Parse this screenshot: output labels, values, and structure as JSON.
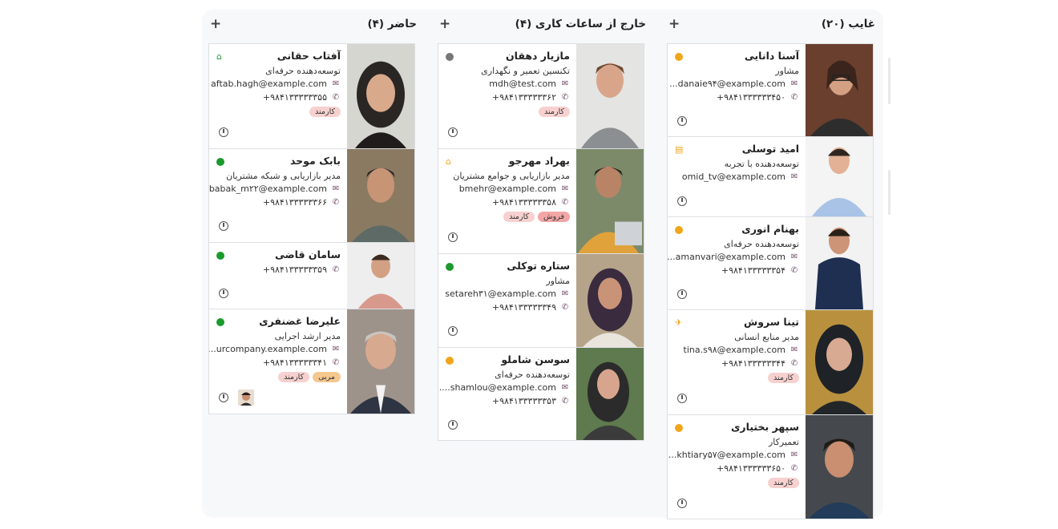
{
  "columns": [
    {
      "title": "غایب (۲۰)",
      "add": "+",
      "cards": [
        {
          "name": "آسنا دانایی",
          "job": "مشاور",
          "email": "...danaie۹۴@example.com",
          "phone": "+۹۸۴۱۳۳۳۳۳۳۴۵۰",
          "tags": [],
          "status": "away"
        },
        {
          "name": "امید توسلی",
          "job": "توسعه‌دهنده با تجربه",
          "email": "omid_tv@example.com",
          "phone": "",
          "tags": [],
          "status": "leave-icon"
        },
        {
          "name": "بهنام انوری",
          "job": "توسعه‌دهنده حرفه‌ای",
          "email": "...amanvari@example.com",
          "phone": "+۹۸۴۱۳۳۳۳۳۳۵۴",
          "tags": [],
          "status": "away"
        },
        {
          "name": "تینا سروش",
          "job": "مدیر منابع انسانی",
          "email": "tina.s۹۸@example.com",
          "phone": "+۹۸۴۱۳۳۳۳۳۳۴۴",
          "tags": [
            "کارمند"
          ],
          "status": "plane-icon"
        },
        {
          "name": "سپهر بختیاری",
          "job": "تعمیرکار",
          "email": "...khtiary۵۷@example.com",
          "phone": "+۹۸۴۱۳۳۳۳۳۳۶۵۰",
          "tags": [
            "کارمند"
          ],
          "status": "away"
        }
      ]
    },
    {
      "title": "خارج از ساعات کاری (۴)",
      "add": "+",
      "cards": [
        {
          "name": "مازیار دهقان",
          "job": "تکنسین تعمیر و نگهداری",
          "email": "mdh@test.com",
          "phone": "+۹۸۴۱۳۳۳۳۳۳۶۲",
          "tags": [
            "کارمند"
          ],
          "status": "offline"
        },
        {
          "name": "بهراد مهرجو",
          "job": "مدیر بازاریابی و جوامع مشتریان",
          "email": "bmehr@example.com",
          "phone": "+۹۸۴۱۳۳۳۳۳۳۵۸",
          "tags": [
            "فروش",
            "کارمند"
          ],
          "status": "home-orange"
        },
        {
          "name": "ستاره توکلی",
          "job": "مشاور",
          "email": "setareh۳۱@example.com",
          "phone": "+۹۸۴۱۳۳۳۳۳۳۴۹",
          "tags": [],
          "status": "online"
        },
        {
          "name": "سوسن شاملو",
          "job": "توسعه‌دهنده حرفه‌ای",
          "email": "....shamlou@example.com",
          "phone": "+۹۸۴۱۳۳۳۳۳۳۵۳",
          "tags": [],
          "status": "away"
        }
      ]
    },
    {
      "title": "حاضر (۴)",
      "add": "+",
      "cards": [
        {
          "name": "آفتاب حقانی",
          "job": "توسعه‌دهنده حرفه‌ای",
          "email": "aftab.hagh@example.com",
          "phone": "+۹۸۴۱۳۳۳۳۳۳۵۵",
          "tags": [
            "کارمند"
          ],
          "status": "home-green"
        },
        {
          "name": "بابک موحد",
          "job": "مدیر بازاریابی و شبکه مشتریان",
          "email": "babak_m۲۲@example.com",
          "phone": "+۹۸۴۱۳۳۳۳۳۳۶۶",
          "tags": [],
          "status": "online"
        },
        {
          "name": "سامان قاضی",
          "job": "",
          "email": "",
          "phone": "+۹۸۴۱۳۳۳۳۳۳۵۹",
          "tags": [],
          "status": "online"
        },
        {
          "name": "علیرضا غضنفری",
          "job": "مدیر ارشد اجرایی",
          "email": "...urcompany.example.com",
          "phone": "+۹۸۴۱۳۳۳۳۳۳۴۱",
          "tags": [
            "مربی",
            "کارمند"
          ],
          "status": "online"
        }
      ]
    }
  ],
  "colors": {
    "online": "#1a9a2c",
    "away": "#f0a51a",
    "offline": "#777777",
    "accent": "#714b67",
    "tag": "#f6d1cf",
    "tag_orange": "#f5c890",
    "tag_red": "#f3a6a6"
  }
}
